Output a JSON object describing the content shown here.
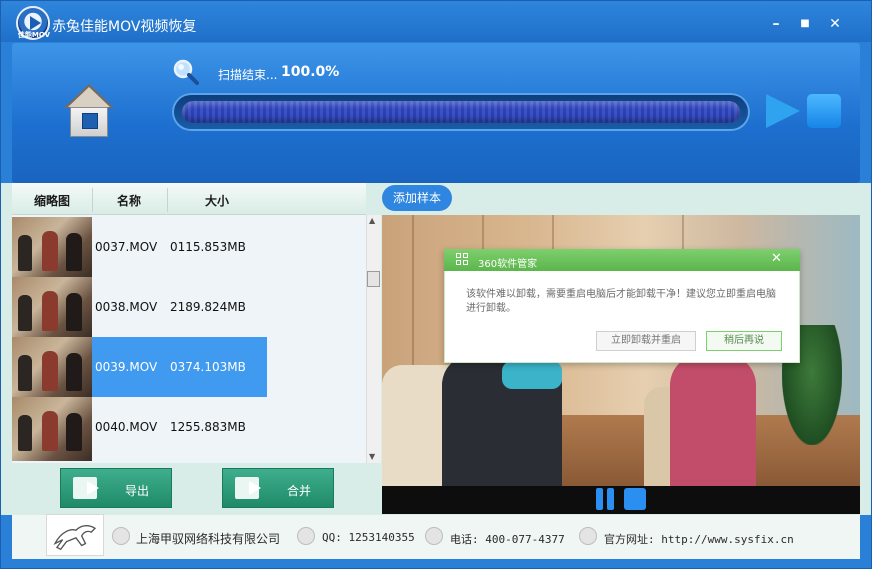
{
  "window": {
    "title": "赤兔佳能MOV视频恢复",
    "logo_text": "佳能MOV",
    "minimize_glyph": "–",
    "maximize_glyph": "■",
    "close_glyph": "✕"
  },
  "scan": {
    "status_label": "扫描结束...",
    "percent_text": "100.0%",
    "progress": 1.0
  },
  "file_list": {
    "columns": [
      "缩略图",
      "名称",
      "大小"
    ],
    "rows": [
      {
        "name": "0037.MOV",
        "size": "0115.853MB",
        "selected": false
      },
      {
        "name": "0038.MOV",
        "size": "2189.824MB",
        "selected": false
      },
      {
        "name": "0039.MOV",
        "size": "0374.103MB",
        "selected": true
      },
      {
        "name": "0040.MOV",
        "size": "1255.883MB",
        "selected": false
      }
    ],
    "scroll_up": "▲",
    "scroll_down": "▼"
  },
  "actions": {
    "export_label": "导出",
    "merge_label": "合并"
  },
  "preview": {
    "add_sample_label": "添加样本"
  },
  "popup": {
    "title": "360软件管家",
    "close_glyph": "✕",
    "message": "该软件难以卸载，需要重启电脑后才能卸载干净！建议您立即重启电脑进行卸载。",
    "uninstall_label": "立即卸载并重启",
    "later_label": "稍后再说"
  },
  "footer": {
    "company": "上海甲驭网络科技有限公司",
    "qq": "QQ: 1253140355",
    "phone": "电话: 400-077-4377",
    "website": "官方网址: http://www.sysfix.cn"
  },
  "colors": {
    "accent_blue": "#2f86e0",
    "selected_row": "#3f9af0",
    "button_green": "#2a9a77",
    "popup_green": "#6cc35c"
  }
}
